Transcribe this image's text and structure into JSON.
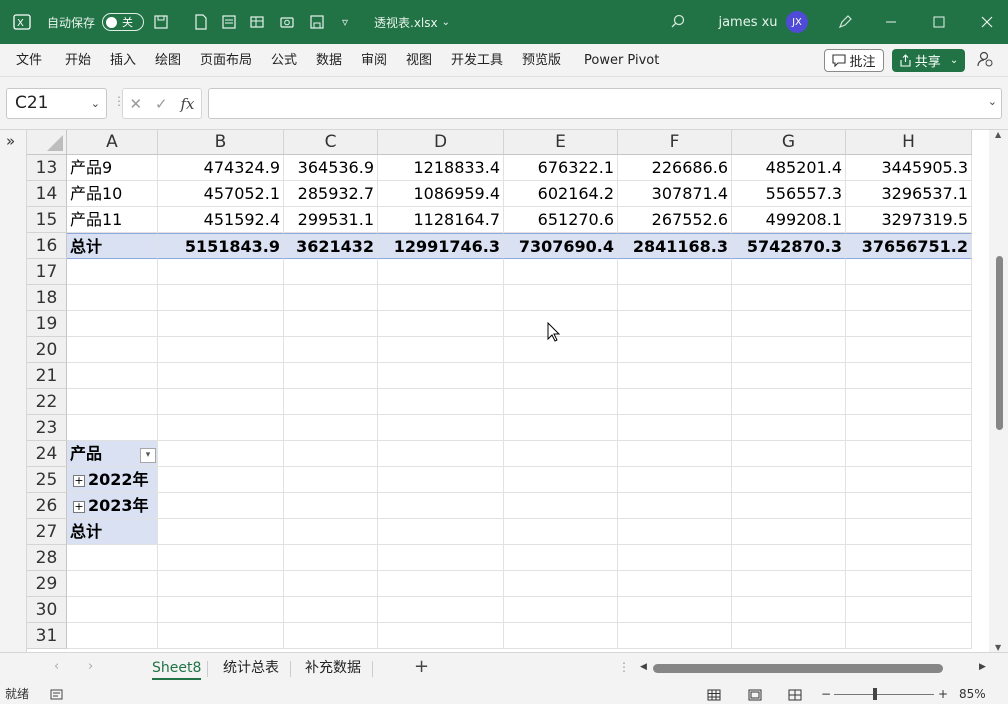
{
  "titlebar": {
    "autosave_label": "自动保存",
    "autosave_state": "关",
    "filename": "透视表.xlsx",
    "user": "james xu",
    "avatar_initials": "JX"
  },
  "menu": [
    "文件",
    "开始",
    "插入",
    "绘图",
    "页面布局",
    "公式",
    "数据",
    "审阅",
    "视图",
    "开发工具",
    "预览版",
    "Power Pivot"
  ],
  "actions": {
    "comment_label": "批注",
    "share_label": "共享"
  },
  "formula_bar": {
    "name_box": "C21",
    "fx_label": "fx",
    "formula": ""
  },
  "columns": [
    "A",
    "B",
    "C",
    "D",
    "E",
    "F",
    "G",
    "H"
  ],
  "rows": [
    {
      "num": "13",
      "cells": [
        "产品9",
        "474324.9",
        "364536.9",
        "1218833.4",
        "676322.1",
        "226686.6",
        "485201.4",
        "3445905.3"
      ]
    },
    {
      "num": "14",
      "cells": [
        "产品10",
        "457052.1",
        "285932.7",
        "1086959.4",
        "602164.2",
        "307871.4",
        "556557.3",
        "3296537.1"
      ]
    },
    {
      "num": "15",
      "cells": [
        "产品11",
        "451592.4",
        "299531.1",
        "1128164.7",
        "651270.6",
        "267552.6",
        "499208.1",
        "3297319.5"
      ]
    },
    {
      "num": "16",
      "cells": [
        "总计",
        "5151843.9",
        "3621432",
        "12991746.3",
        "7307690.4",
        "2841168.3",
        "5742870.3",
        "37656751.2"
      ]
    },
    {
      "num": "17",
      "cells": []
    },
    {
      "num": "18",
      "cells": []
    },
    {
      "num": "19",
      "cells": []
    },
    {
      "num": "20",
      "cells": []
    },
    {
      "num": "21",
      "cells": []
    },
    {
      "num": "22",
      "cells": []
    },
    {
      "num": "23",
      "cells": []
    },
    {
      "num": "24",
      "cells": [
        "产品"
      ]
    },
    {
      "num": "25",
      "cells": [
        "2022年"
      ]
    },
    {
      "num": "26",
      "cells": [
        "2023年"
      ]
    },
    {
      "num": "27",
      "cells": [
        "总计"
      ]
    },
    {
      "num": "28",
      "cells": []
    },
    {
      "num": "29",
      "cells": []
    },
    {
      "num": "30",
      "cells": []
    },
    {
      "num": "31",
      "cells": []
    }
  ],
  "sheets": [
    "Sheet8",
    "统计总表",
    "补充数据"
  ],
  "active_sheet": "Sheet8",
  "status": {
    "ready": "就绪",
    "zoom": "85%"
  },
  "colors": {
    "excel_green": "#217346",
    "pivot_fill": "#d9e1f2",
    "avatar": "#4f4bd6"
  }
}
